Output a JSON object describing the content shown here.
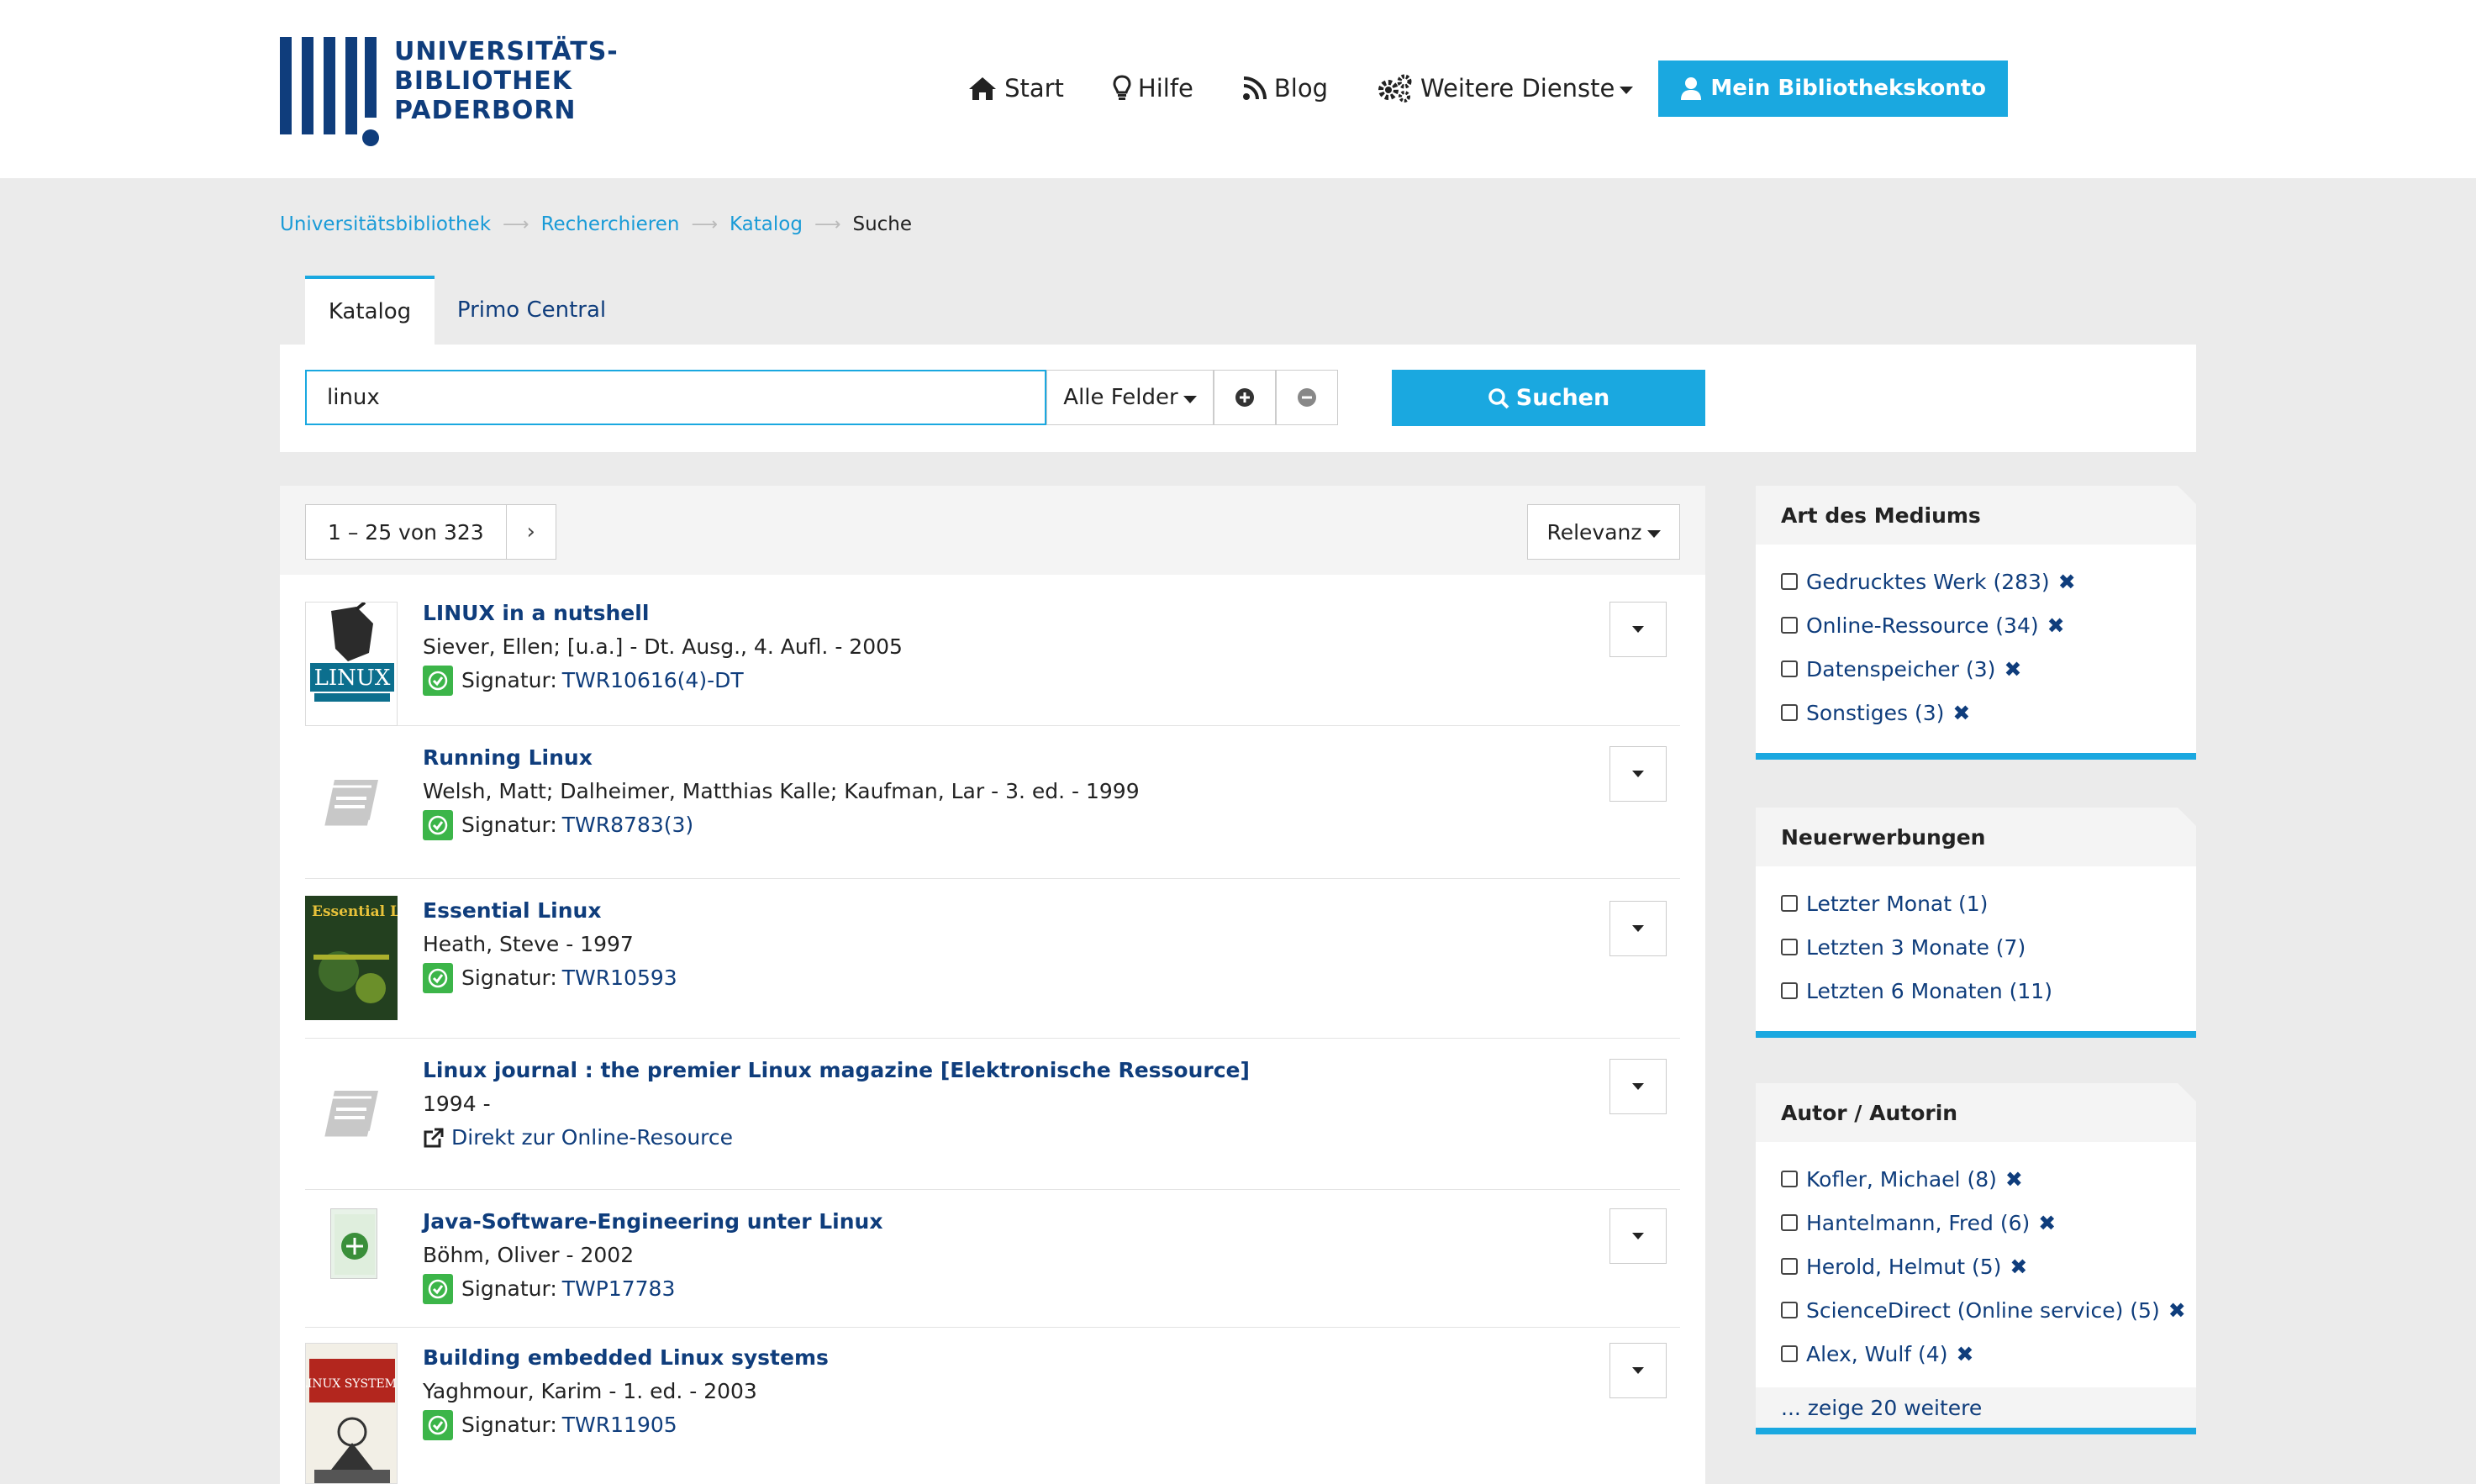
{
  "header": {
    "logo_lines": [
      "UNIVERSITÄTS-",
      "BIBLIOTHEK",
      "PADERBORN"
    ],
    "nav": [
      {
        "label": "Start",
        "icon": "home-icon"
      },
      {
        "label": "Hilfe",
        "icon": "lightbulb-icon"
      },
      {
        "label": "Blog",
        "icon": "rss-icon"
      },
      {
        "label": "Weitere Dienste",
        "icon": "gears-icon"
      }
    ],
    "account_label": "Mein Bibliothekskonto"
  },
  "breadcrumb": {
    "items": [
      "Universitätsbibliothek",
      "Recherchieren",
      "Katalog"
    ],
    "current": "Suche"
  },
  "tabs": [
    "Katalog",
    "Primo Central"
  ],
  "search": {
    "query": "linux",
    "field": "Alle Felder",
    "button": "Suchen"
  },
  "results_bar": {
    "count": "1 – 25 von 323",
    "next": "›",
    "sort": "Relevanz"
  },
  "results": [
    {
      "title": "LINUX in a nutshell",
      "meta": "Siever, Ellen; [u.a.] - Dt. Ausg., 4. Aufl. - 2005",
      "sig_label": "Signatur:",
      "sig": "TWR10616(4)-DT",
      "cover": "LINUX"
    },
    {
      "title": "Running Linux",
      "meta": "Welsh, Matt; Dalheimer, Matthias Kalle; Kaufman, Lar - 3. ed. - 1999",
      "sig_label": "Signatur:",
      "sig": "TWR8783(3)",
      "cover": ""
    },
    {
      "title": "Essential Linux",
      "meta": "Heath, Steve - 1997",
      "sig_label": "Signatur:",
      "sig": "TWR10593",
      "cover": "Essential Linux"
    },
    {
      "title": "Linux journal : the premier Linux magazine [Elektronische Ressource]",
      "meta": "1994 -",
      "online": "Direkt zur Online-Resource",
      "cover": ""
    },
    {
      "title": "Java-Software-Engineering unter Linux",
      "meta": "Böhm, Oliver - 2002",
      "sig_label": "Signatur:",
      "sig": "TWP17783",
      "cover": ""
    },
    {
      "title": "Building embedded Linux systems",
      "meta": "Yaghmour, Karim - 1. ed. - 2003",
      "sig_label": "Signatur:",
      "sig": "TWR11905",
      "cover": "LINUX SYSTEMS"
    }
  ],
  "facets": [
    {
      "title": "Art des Mediums",
      "items": [
        {
          "label": "Gedrucktes Werk (283)",
          "x": "✖"
        },
        {
          "label": "Online-Ressource (34)",
          "x": "✖"
        },
        {
          "label": "Datenspeicher (3)",
          "x": "✖"
        },
        {
          "label": "Sonstiges (3)",
          "x": "✖"
        }
      ]
    },
    {
      "title": "Neuerwerbungen",
      "items": [
        {
          "label": "Letzter Monat (1)"
        },
        {
          "label": "Letzten 3 Monate (7)"
        },
        {
          "label": "Letzten 6 Monaten (11)"
        }
      ]
    },
    {
      "title": "Autor / Autorin",
      "items": [
        {
          "label": "Kofler, Michael (8)",
          "x": "✖"
        },
        {
          "label": "Hantelmann, Fred (6)",
          "x": "✖"
        },
        {
          "label": "Herold, Helmut (5)",
          "x": "✖"
        },
        {
          "label": "ScienceDirect (Online service) (5)",
          "x": "✖"
        },
        {
          "label": "Alex, Wulf (4)",
          "x": "✖"
        }
      ],
      "more": "... zeige 20 weitere"
    }
  ],
  "colors": {
    "accent": "#1aa8e0",
    "brand": "#0f3d7c",
    "available": "#3cb549"
  }
}
